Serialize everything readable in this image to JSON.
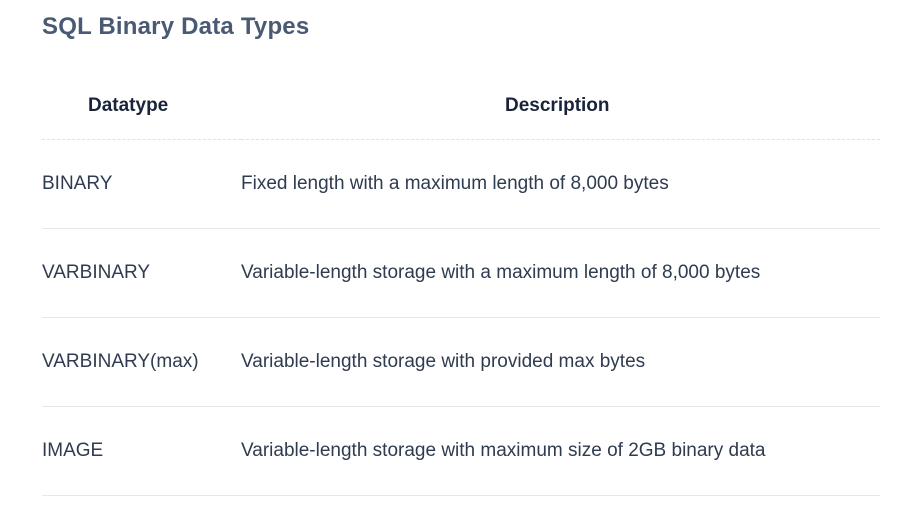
{
  "page": {
    "title": "SQL Binary Data Types"
  },
  "table": {
    "headers": {
      "datatype": "Datatype",
      "description": "Description"
    },
    "rows": [
      {
        "datatype": "BINARY",
        "description": "Fixed length with a maximum length of 8,000 bytes"
      },
      {
        "datatype": "VARBINARY",
        "description": "Variable-length storage with a maximum length of 8,000 bytes"
      },
      {
        "datatype": "VARBINARY(max)",
        "description": "Variable-length storage with provided max bytes"
      },
      {
        "datatype": "IMAGE",
        "description": "Variable-length storage with maximum size of 2GB binary data"
      }
    ]
  },
  "colors": {
    "title": "#4a5a74",
    "header_text": "#19243a",
    "body_text": "#2f3b4f",
    "divider": "#e4e7ec"
  }
}
